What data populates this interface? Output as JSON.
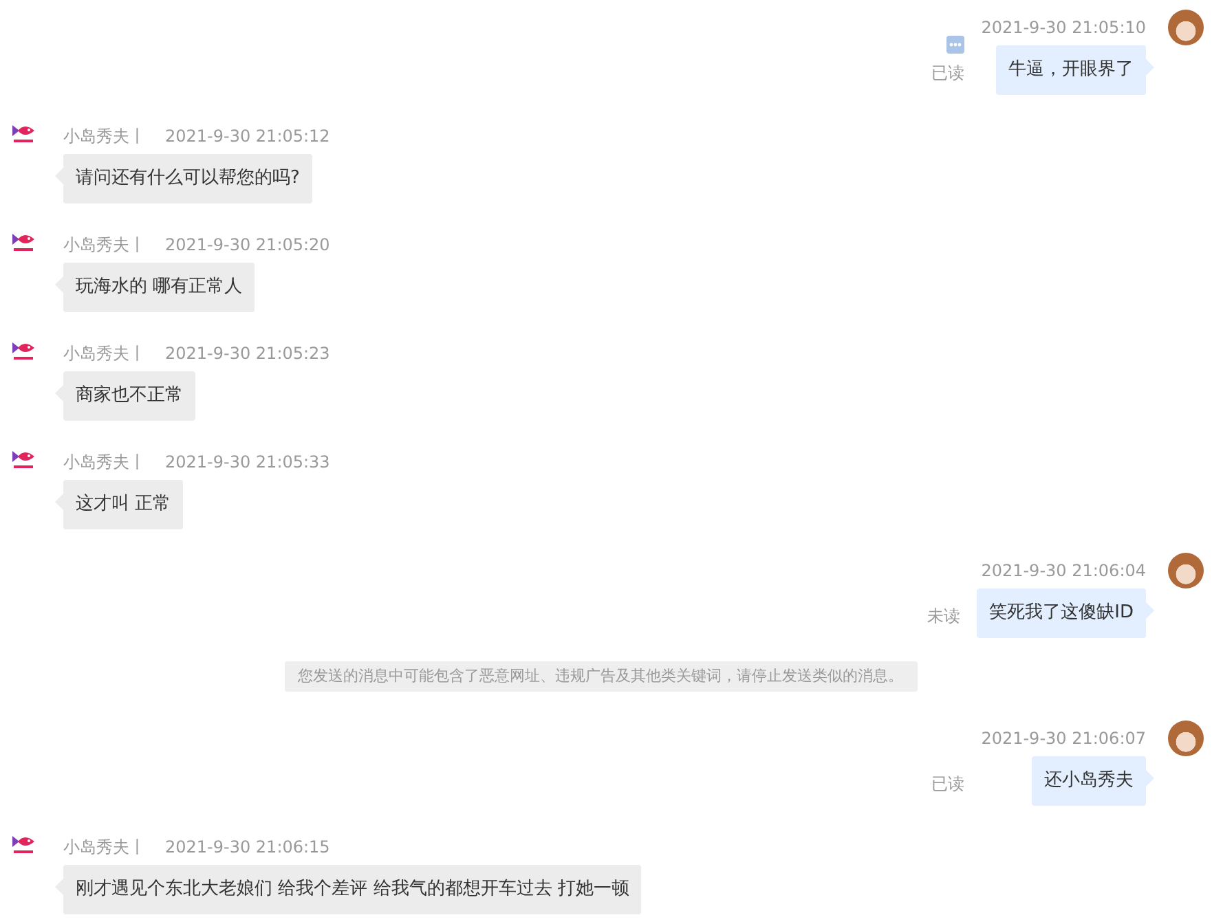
{
  "messages": [
    {
      "kind": "outgoing",
      "time": "2021-9-30 21:05:10",
      "text": "牛逼，开眼界了",
      "status": "已读",
      "options_shown": true
    },
    {
      "kind": "incoming",
      "sender": "小岛秀夫丨",
      "time": "2021-9-30 21:05:12",
      "text": "请问还有什么可以帮您的吗?"
    },
    {
      "kind": "incoming",
      "sender": "小岛秀夫丨",
      "time": "2021-9-30 21:05:20",
      "text": "玩海水的 哪有正常人"
    },
    {
      "kind": "incoming",
      "sender": "小岛秀夫丨",
      "time": "2021-9-30 21:05:23",
      "text": "商家也不正常"
    },
    {
      "kind": "incoming",
      "sender": "小岛秀夫丨",
      "time": "2021-9-30 21:05:33",
      "text": "这才叫 正常"
    },
    {
      "kind": "outgoing",
      "time": "2021-9-30 21:06:04",
      "text": "笑死我了这傻缺ID",
      "status": "未读",
      "options_shown": false
    },
    {
      "kind": "system",
      "text": "您发送的消息中可能包含了恶意网址、违规广告及其他类关键词，请停止发送类似的消息。"
    },
    {
      "kind": "outgoing",
      "time": "2021-9-30 21:06:07",
      "text": "还小岛秀夫",
      "status": "已读",
      "options_shown": false
    },
    {
      "kind": "incoming",
      "sender": "小岛秀夫丨",
      "time": "2021-9-30 21:06:15",
      "text": "刚才遇见个东北大老娘们 给我个差评 给我气的都想开车过去 打她一顿"
    }
  ]
}
